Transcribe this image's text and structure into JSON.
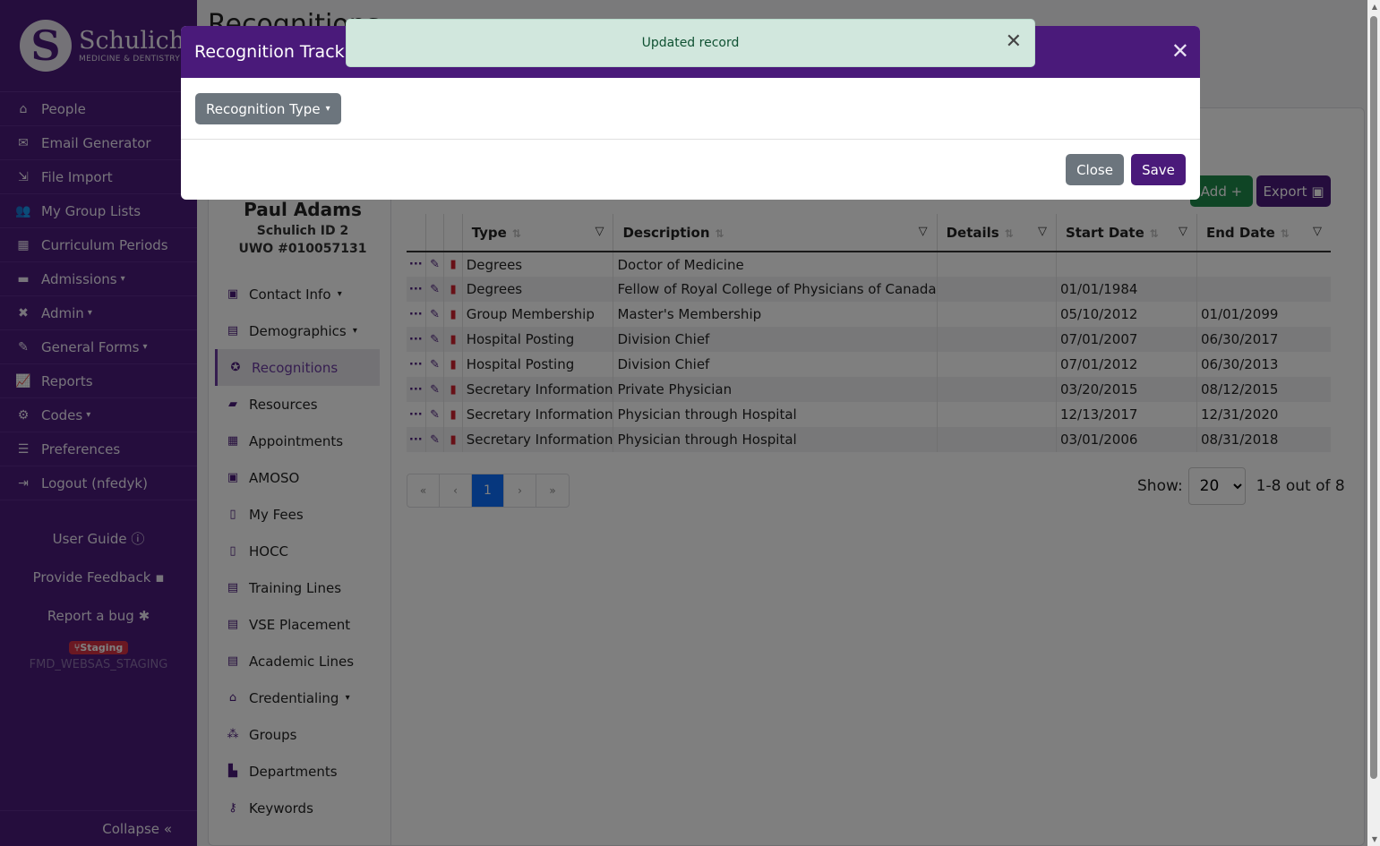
{
  "logo": {
    "name": "Schulich",
    "sub": "MEDICINE & DENTISTRY",
    "mark": "S"
  },
  "sidebar": {
    "items": [
      {
        "label": "People",
        "icon": "home-icon",
        "glyph": "⌂"
      },
      {
        "label": "Email Generator",
        "icon": "envelope-icon",
        "glyph": "✉"
      },
      {
        "label": "File Import",
        "icon": "file-import-icon",
        "glyph": "⇲"
      },
      {
        "label": "My Group Lists",
        "icon": "users-icon",
        "glyph": "👥"
      },
      {
        "label": "Curriculum Periods",
        "icon": "calendar-icon",
        "glyph": "▦"
      },
      {
        "label": "Admissions",
        "icon": "id-card-icon",
        "glyph": "▬",
        "caret": true
      },
      {
        "label": "Admin",
        "icon": "tools-icon",
        "glyph": "✖",
        "caret": true
      },
      {
        "label": "General Forms",
        "icon": "form-edit-icon",
        "glyph": "✎",
        "caret": true
      },
      {
        "label": "Reports",
        "icon": "chart-line-icon",
        "glyph": "📈"
      },
      {
        "label": "Codes",
        "icon": "cogs-icon",
        "glyph": "⚙",
        "caret": true
      },
      {
        "label": "Preferences",
        "icon": "sliders-icon",
        "glyph": "☰"
      },
      {
        "label": "Logout (nfedyk)",
        "icon": "sign-out-icon",
        "glyph": "⇥"
      }
    ],
    "user_guide": "User Guide",
    "feedback": "Provide Feedback",
    "bug": "Report a bug",
    "staging_badge": "Staging",
    "env_name": "FMD_WEBSAS_STAGING",
    "collapse": "Collapse"
  },
  "page": {
    "title": "Recognitions"
  },
  "profile": {
    "name": "Paul Adams",
    "id_line": "Schulich ID 2",
    "uwo_line": "UWO #010057131"
  },
  "subnav": [
    {
      "label": "Contact Info",
      "icon": "address-card-icon",
      "glyph": "▣",
      "caret": true
    },
    {
      "label": "Demographics",
      "icon": "id-badge-icon",
      "glyph": "▤",
      "caret": true
    },
    {
      "label": "Recognitions",
      "icon": "award-icon",
      "glyph": "✪",
      "active": true
    },
    {
      "label": "Resources",
      "icon": "folder-open-icon",
      "glyph": "▰"
    },
    {
      "label": "Appointments",
      "icon": "calendar-check-icon",
      "glyph": "▦"
    },
    {
      "label": "AMOSO",
      "icon": "contact-book-icon",
      "glyph": "▣"
    },
    {
      "label": "My Fees",
      "icon": "file-invoice-icon",
      "glyph": "▯"
    },
    {
      "label": "HOCC",
      "icon": "file-alt-icon",
      "glyph": "▯"
    },
    {
      "label": "Training Lines",
      "icon": "table-list-icon",
      "glyph": "▤"
    },
    {
      "label": "VSE Placement",
      "icon": "table-list-icon",
      "glyph": "▤"
    },
    {
      "label": "Academic Lines",
      "icon": "table-list-icon",
      "glyph": "▤"
    },
    {
      "label": "Credentialing",
      "icon": "house-user-icon",
      "glyph": "⌂",
      "caret": true
    },
    {
      "label": "Groups",
      "icon": "people-group-icon",
      "glyph": "⁂"
    },
    {
      "label": "Departments",
      "icon": "building-icon",
      "glyph": "▙"
    },
    {
      "label": "Keywords",
      "icon": "key-icon",
      "glyph": "⚷"
    }
  ],
  "actions": {
    "add": "Add",
    "export": "Export"
  },
  "table": {
    "columns": [
      "Type",
      "Description",
      "Details",
      "Start Date",
      "End Date"
    ],
    "rows": [
      {
        "type": "Degrees",
        "description": "Doctor of Medicine",
        "details": "",
        "start": "",
        "end": ""
      },
      {
        "type": "Degrees",
        "description": "Fellow of Royal College of Physicians of Canada",
        "details": "",
        "start": "01/01/1984",
        "end": ""
      },
      {
        "type": "Group Membership",
        "description": "Master's Membership",
        "details": "",
        "start": "05/10/2012",
        "end": "01/01/2099"
      },
      {
        "type": "Hospital Posting",
        "description": "Division Chief",
        "details": "",
        "start": "07/01/2007",
        "end": "06/30/2017"
      },
      {
        "type": "Hospital Posting",
        "description": "Division Chief",
        "details": "",
        "start": "07/01/2012",
        "end": "06/30/2013"
      },
      {
        "type": "Secretary Information",
        "description": "Private Physician",
        "details": "",
        "start": "03/20/2015",
        "end": "08/12/2015"
      },
      {
        "type": "Secretary Information",
        "description": "Physician through Hospital",
        "details": "",
        "start": "12/13/2017",
        "end": "12/31/2020"
      },
      {
        "type": "Secretary Information",
        "description": "Physician through Hospital",
        "details": "",
        "start": "03/01/2006",
        "end": "08/31/2018"
      }
    ]
  },
  "pager": {
    "first": "«",
    "prev": "‹",
    "current": "1",
    "next": "›",
    "last": "»"
  },
  "show": {
    "label": "Show:",
    "value": "20",
    "summary": "1-8 out of 8"
  },
  "modal": {
    "title": "Recognition Tracking",
    "type_button": "Recognition Type",
    "close": "Close",
    "save": "Save"
  },
  "toast": {
    "message": "Updated record"
  },
  "colors": {
    "brand": "#4a1a7a",
    "success": "#1e8a4a",
    "toast_bg": "#d1e7dd",
    "danger": "#d0202f"
  }
}
